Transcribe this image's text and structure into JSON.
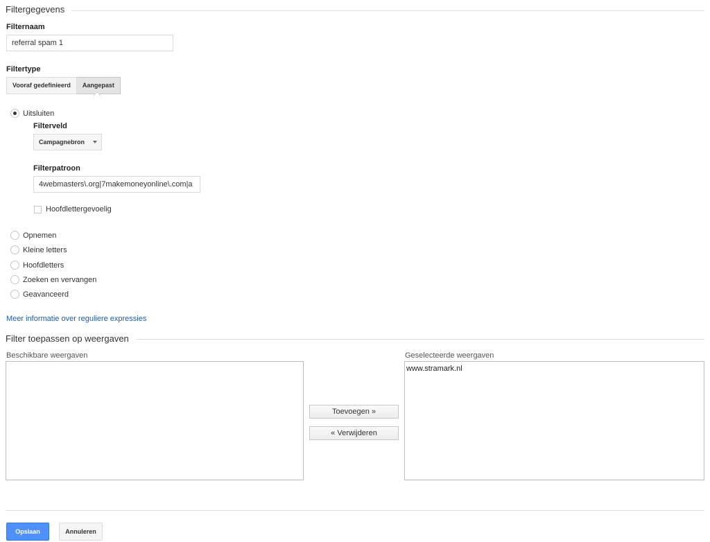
{
  "filter_data": {
    "section_title": "Filtergegevens",
    "name_label": "Filternaam",
    "name_value": "referral spam 1",
    "type_label": "Filtertype",
    "type_tabs": [
      "Vooraf gedefinieerd",
      "Aangepast"
    ],
    "active_tab": "Aangepast"
  },
  "options": {
    "exclude": {
      "label": "Uitsluiten",
      "checked": true
    },
    "field_label": "Filterveld",
    "field_value": "Campagnebron",
    "pattern_label": "Filterpatroon",
    "pattern_value": "4webmasters\\.org|7makemoneyonline\\.com|a",
    "case_sensitive_label": "Hoofdlettergevoelig",
    "case_sensitive_checked": false,
    "other_options": [
      "Opnemen",
      "Kleine letters",
      "Hoofdletters",
      "Zoeken en vervangen",
      "Geavanceerd"
    ]
  },
  "regex_link": "Meer informatie over reguliere expressies",
  "apply": {
    "section_title": "Filter toepassen op weergaven",
    "available_label": "Beschikbare weergaven",
    "available_items": [],
    "selected_label": "Geselecteerde weergaven",
    "selected_items": [
      "www.stramark.nl"
    ],
    "add_button": "Toevoegen »",
    "remove_button": "« Verwijderen"
  },
  "footer": {
    "save_button": "Opslaan",
    "cancel_button": "Annuleren"
  },
  "colors": {
    "link": "#1a5cb6",
    "primary_button": "#4d90fe"
  }
}
